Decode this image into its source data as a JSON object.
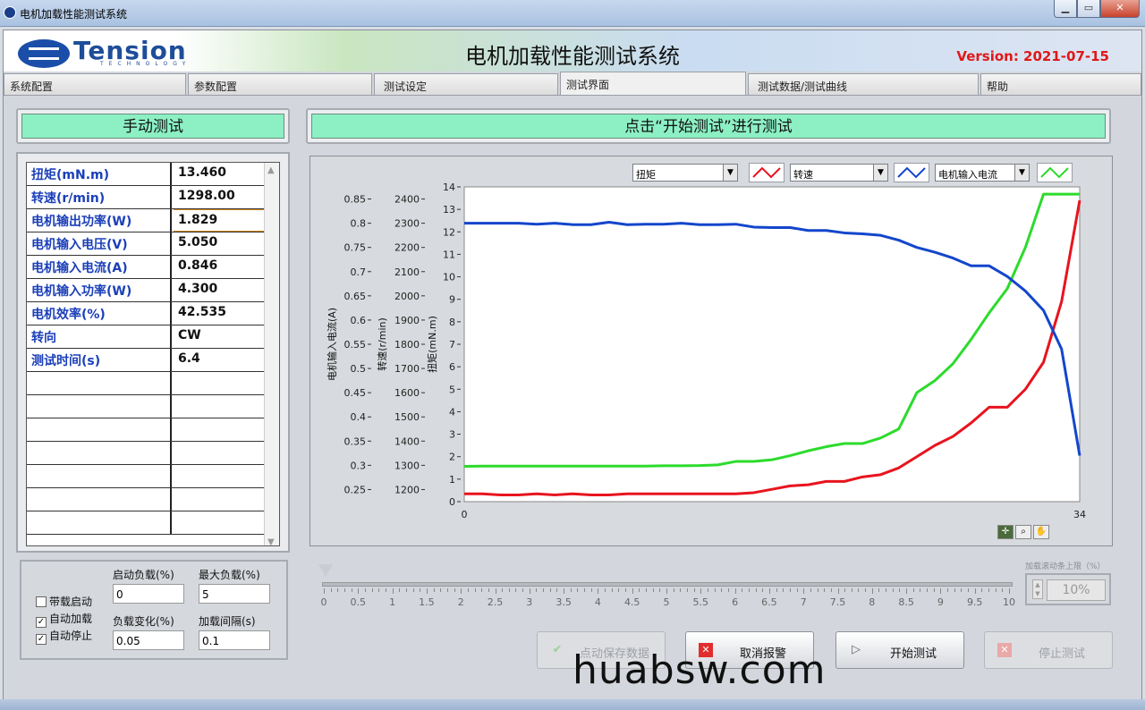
{
  "window": {
    "title": "电机加载性能测试系统"
  },
  "header": {
    "logo_text": "Tension",
    "logo_sub": "TECHNOLOGY",
    "app_title": "电机加载性能测试系统",
    "version": "Version: 2021-07-15"
  },
  "tabs": [
    {
      "label": "系统配置",
      "active": false
    },
    {
      "label": "参数配置",
      "active": false
    },
    {
      "label": "测试设定",
      "active": false
    },
    {
      "label": "测试界面",
      "active": true
    },
    {
      "label": "测试数据/测试曲线",
      "active": false
    },
    {
      "label": "帮助",
      "active": false
    }
  ],
  "left_banner": "手动测试",
  "right_banner": "点击“开始测试”进行测试",
  "readings": [
    {
      "label": "扭矩(mN.m)",
      "value": "13.460"
    },
    {
      "label": "转速(r/min)",
      "value": "1298.00"
    },
    {
      "label": "电机输出功率(W)",
      "value": "1.829"
    },
    {
      "label": "电机输入电压(V)",
      "value": "5.050"
    },
    {
      "label": "电机输入电流(A)",
      "value": "0.846"
    },
    {
      "label": "电机输入功率(W)",
      "value": "4.300"
    },
    {
      "label": "电机效率(%)",
      "value": "42.535"
    },
    {
      "label": "转向",
      "value": "CW"
    },
    {
      "label": "测试时间(s)",
      "value": "6.4"
    }
  ],
  "legend": {
    "sel1": "扭矩",
    "sel2": "转速",
    "sel3": "电机输入电流"
  },
  "chart_data": {
    "type": "line",
    "x": [
      0,
      1,
      2,
      3,
      4,
      5,
      6,
      7,
      8,
      9,
      10,
      11,
      12,
      13,
      14,
      15,
      16,
      17,
      18,
      19,
      20,
      21,
      22,
      23,
      24,
      25,
      26,
      27,
      28,
      29,
      30,
      31,
      32,
      33,
      34
    ],
    "xlim": [
      0,
      34
    ],
    "xticks": [
      "0",
      "34"
    ],
    "y_axes": [
      {
        "label": "扭矩(mN.m)",
        "ylim": [
          0,
          14
        ],
        "ticks": [
          "0",
          "1",
          "2",
          "3",
          "4",
          "5",
          "6",
          "7",
          "8",
          "9",
          "10",
          "11",
          "12",
          "13",
          "14"
        ]
      },
      {
        "label": "转速(r/min)",
        "ylim": [
          1150,
          2450
        ],
        "ticks": [
          "1200",
          "1300",
          "1400",
          "1500",
          "1600",
          "1700",
          "1800",
          "1900",
          "2000",
          "2100",
          "2200",
          "2300",
          "2400"
        ]
      },
      {
        "label": "电机输入电流(A)",
        "ylim": [
          0.225,
          0.875
        ],
        "ticks": [
          "0.25",
          "0.3",
          "0.35",
          "0.4",
          "0.45",
          "0.5",
          "0.55",
          "0.6",
          "0.65",
          "0.7",
          "0.75",
          "0.8",
          "0.85"
        ]
      }
    ],
    "grid": false,
    "series": [
      {
        "name": "扭矩",
        "axis": 0,
        "color": "#e8141e",
        "values": [
          0.35,
          0.35,
          0.3,
          0.3,
          0.35,
          0.3,
          0.35,
          0.3,
          0.3,
          0.35,
          0.35,
          0.35,
          0.35,
          0.35,
          0.35,
          0.35,
          0.4,
          0.55,
          0.7,
          0.75,
          0.9,
          0.9,
          1.1,
          1.2,
          1.5,
          2.0,
          2.5,
          2.9,
          3.5,
          4.2,
          4.2,
          5.0,
          6.2,
          8.9,
          13.4
        ]
      },
      {
        "name": "转速",
        "axis": 1,
        "color": "#2cdb2c",
        "values": [
          1296,
          1297,
          1297,
          1297,
          1297,
          1297,
          1297,
          1297,
          1297,
          1297,
          1297,
          1298,
          1298,
          1299,
          1302,
          1316,
          1316,
          1323,
          1340,
          1360,
          1377,
          1390,
          1390,
          1413,
          1450,
          1600,
          1650,
          1720,
          1820,
          1930,
          2030,
          2200,
          2420,
          2420,
          2420
        ]
      },
      {
        "name": "电机输入电流",
        "axis": 2,
        "color": "#1446cc",
        "values": [
          0.8,
          0.8,
          0.8,
          0.8,
          0.798,
          0.8,
          0.797,
          0.797,
          0.802,
          0.797,
          0.798,
          0.798,
          0.8,
          0.797,
          0.797,
          0.798,
          0.792,
          0.791,
          0.791,
          0.785,
          0.785,
          0.78,
          0.778,
          0.775,
          0.765,
          0.75,
          0.74,
          0.728,
          0.712,
          0.712,
          0.69,
          0.66,
          0.62,
          0.54,
          0.32
        ]
      }
    ]
  },
  "settings": {
    "cb1": "带载启动",
    "cb1_checked": false,
    "cb2": "自动加载",
    "cb2_checked": true,
    "cb3": "自动停止",
    "cb3_checked": true,
    "start_load_label": "启动负载(%)",
    "start_load": "0",
    "max_load_label": "最大负载(%)",
    "max_load": "5",
    "load_step_label": "负载变化(%)",
    "load_step": "0.05",
    "load_interval_label": "加载间隔(s)",
    "load_interval": "0.1"
  },
  "slider": {
    "labels": [
      "0",
      "0.5",
      "1",
      "1.5",
      "2",
      "2.5",
      "3",
      "3.5",
      "4",
      "4.5",
      "5",
      "5.5",
      "6",
      "6.5",
      "7",
      "7.5",
      "8",
      "8.5",
      "9",
      "9.5",
      "10"
    ],
    "value": 0
  },
  "upper_limit": {
    "label": "加载滚动条上限（%）",
    "value": "10%"
  },
  "buttons": {
    "save": "点动保存数据",
    "cancel_alarm": "取消报警",
    "start": "开始测试",
    "stop": "停止测试"
  },
  "watermark": "huabsw.com",
  "colors": {
    "banner": "#8cf0c4",
    "version": "#e01818",
    "label_blue": "#1b3fb8"
  }
}
